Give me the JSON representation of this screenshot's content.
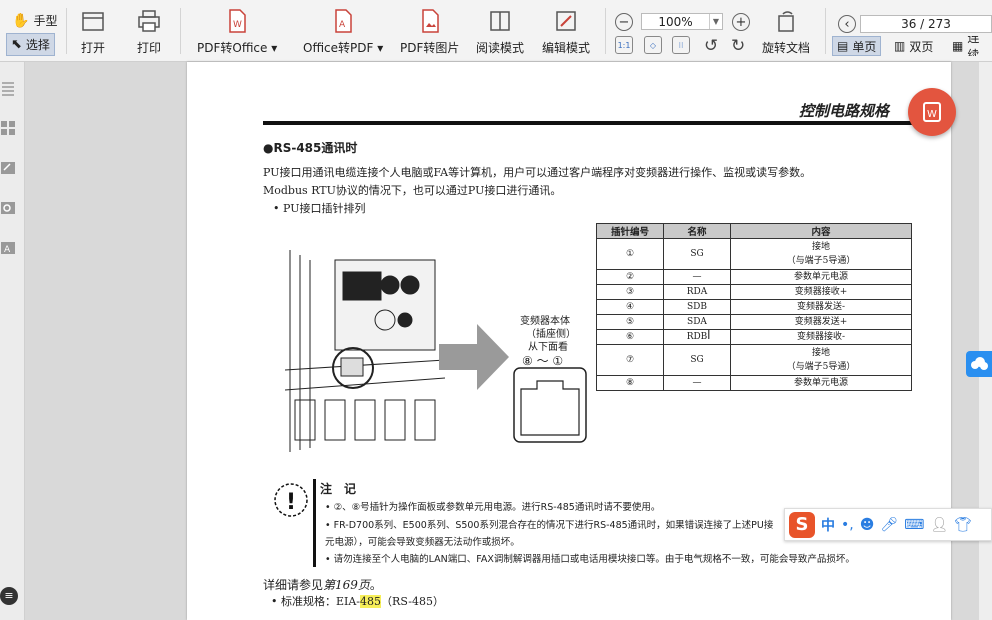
{
  "toolbar": {
    "hand_tool": "手型",
    "select_tool": "选择",
    "buttons": {
      "open": "打开",
      "print": "打印",
      "pdf_to_office": "PDF转Office",
      "office_to_pdf": "Office转PDF",
      "pdf_to_image": "PDF转图片",
      "read_mode": "阅读模式",
      "edit_mode": "编辑模式",
      "rotate": "旋转文档"
    },
    "zoom_value": "100%",
    "page_indicator": "36 / 273",
    "view_single": "单页",
    "view_double": "双页",
    "view_continuous": "连续"
  },
  "document": {
    "header_title": "控制电路规格",
    "section_title": "●RS-485通讯时",
    "paragraph1": "PU接口用通讯电缆连接个人电脑或FA等计算机，用户可以通过客户端程序对变频器进行操作、监视或读写参数。",
    "paragraph2": "Modbus RTU协议的情况下，也可以通过PU接口进行通讯。",
    "bullet_pu_pins": "• PU接口插针排列",
    "figure_label1": "变频器本体",
    "figure_label2": "（插座侧）",
    "figure_label3": "从下面看",
    "figure_pins": "⑧ ～ ①",
    "pin_table": {
      "headers": [
        "插针编号",
        "名称",
        "内容"
      ],
      "rows": [
        [
          "①",
          "SG",
          "接地",
          "（与端子5导通）"
        ],
        [
          "②",
          "—",
          "参数单元电源",
          ""
        ],
        [
          "③",
          "RDA",
          "变频器接收+",
          ""
        ],
        [
          "④",
          "SDB",
          "变频器发送-",
          ""
        ],
        [
          "⑤",
          "SDA",
          "变频器发送+",
          ""
        ],
        [
          "⑥",
          "RDB",
          "变频器接收-",
          ""
        ],
        [
          "⑦",
          "SG",
          "接地",
          "（与端子5导通）"
        ],
        [
          "⑧",
          "—",
          "参数单元电源",
          ""
        ]
      ]
    },
    "note_title": "注　记",
    "notes": [
      "• ②、⑧号插针为操作面板或参数单元用电源。进行RS-485通讯时请不要使用。",
      "• FR-D700系列、E500系列、S500系列混合存在的情况下进行RS-485通讯时，如果错误连接了上述PU接",
      "  元电源），可能会导致变频器无法动作或损坏。",
      "• 请勿连接至个人电脑的LAN端口、FAX调制解调器用插口或电话用模块接口等。由于电气规格不一致，可能会导致产品损坏。"
    ],
    "see_also_prefix": "详细请参见",
    "see_also_link": "第169页",
    "see_also_suffix": "。",
    "std_prefix": "• 标准规格：EIA-",
    "std_highlight": "485",
    "std_suffix": "（RS-485）"
  },
  "ime_bar": {
    "logo": "S",
    "lang": "中",
    "punct": "•,"
  },
  "colors": {
    "accent_red": "#e3553f",
    "highlight_yellow": "#f7ef5a",
    "table_header": "#c9c9c9"
  }
}
